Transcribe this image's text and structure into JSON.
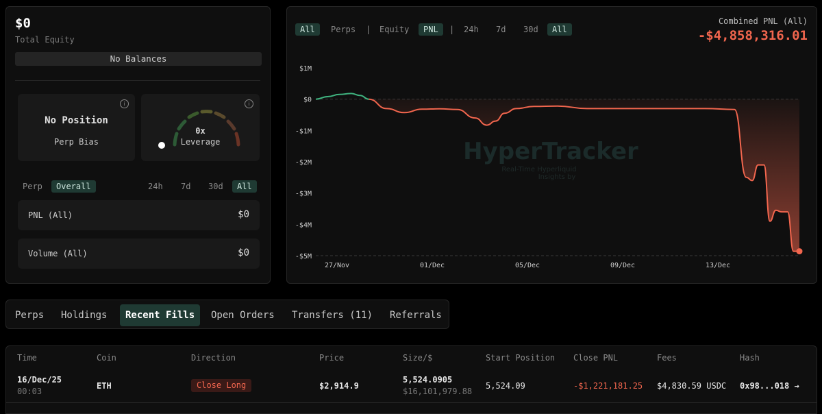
{
  "account": {
    "equity_value": "$0",
    "equity_label": "Total Equity",
    "no_balances": "No Balances"
  },
  "bias_card": {
    "title": "No Position",
    "subtitle": "Perp Bias",
    "info": "i"
  },
  "leverage_card": {
    "value": "0x",
    "label": "Leverage",
    "info": "i",
    "level": 0
  },
  "left_tabs": {
    "type_tabs": [
      "Perp",
      "Overall"
    ],
    "type_active": "Overall",
    "range_tabs": [
      "24h",
      "7d",
      "30d",
      "All"
    ],
    "range_active": "All"
  },
  "stats": [
    {
      "label": "PNL (All)",
      "value": "$0"
    },
    {
      "label": "Volume (All)",
      "value": "$0"
    }
  ],
  "chart_panel": {
    "market_tabs": [
      "All",
      "Perps",
      "Equity",
      "PNL"
    ],
    "separator": "|",
    "range_tabs": [
      "24h",
      "7d",
      "30d",
      "All"
    ],
    "combined_label": "Combined PNL (All)",
    "combined_value": "-$4,858,316.01",
    "watermark_title": "HyperTracker",
    "watermark_line1": "Real-Time Hyperliquid",
    "watermark_line2": "Insights by"
  },
  "colors": {
    "accent": "#1f3a33",
    "negative": "#f2664e",
    "positive": "#3fb37f",
    "panel": "#0f0f0f"
  },
  "chart_data": {
    "type": "area",
    "title": "Combined PNL (All)",
    "xlabel": "",
    "ylabel": "",
    "x_ticks": [
      "27/Nov",
      "01/Dec",
      "05/Dec",
      "09/Dec",
      "13/Dec"
    ],
    "y_ticks": [
      "$1M",
      "$0",
      "-$1M",
      "-$2M",
      "-$3M",
      "-$4M",
      "-$5M"
    ],
    "ylim": [
      -5000000,
      1000000
    ],
    "xlim": [
      25.8,
      42.2
    ],
    "x_note": "day index: 27=27/Nov, 31=01/Dec, 35=05/Dec, 39=09/Dec, 43=13/Dec",
    "grid": false,
    "series": [
      {
        "name": "PNL",
        "x": [
          25.8,
          26.2,
          26.6,
          27.0,
          27.3,
          27.6,
          28.2,
          28.8,
          29.4,
          30.0,
          30.6,
          31.2,
          31.6,
          31.9,
          32.2,
          32.6,
          33.2,
          34.0,
          35.0,
          36.0,
          37.0,
          38.0,
          39.0,
          40.0,
          40.4,
          40.6,
          40.8,
          41.0,
          41.2,
          41.4,
          41.6,
          41.8,
          42.0,
          42.2
        ],
        "values": [
          0,
          80000,
          150000,
          180000,
          120000,
          0,
          -300000,
          -430000,
          -320000,
          -310000,
          -330000,
          -600000,
          -830000,
          -700000,
          -450000,
          -300000,
          -230000,
          -220000,
          -300000,
          -300000,
          -300000,
          -300000,
          -300000,
          -330000,
          -2500000,
          -2600000,
          -2100000,
          -2100000,
          -3900000,
          -3550000,
          -3600000,
          -3600000,
          -4860000,
          -4860000
        ]
      }
    ]
  },
  "bottom_tabs": [
    "Perps",
    "Holdings",
    "Recent Fills",
    "Open Orders",
    "Transfers (11)",
    "Referrals"
  ],
  "bottom_tab_active": "Recent Fills",
  "table": {
    "headers": [
      "Time",
      "Coin",
      "Direction",
      "Price",
      "Size/$",
      "Start Position",
      "Close PNL",
      "Fees",
      "Hash"
    ],
    "rows": [
      {
        "date": "16/Dec/25",
        "time": "00:03",
        "coin": "ETH",
        "direction": "Close Long",
        "price": "$2,914.9",
        "size": "5,524.0905",
        "size_usd": "$16,101,979.88",
        "start_position": "5,524.09",
        "close_pnl": "-$1,221,181.25",
        "fees": "$4,830.59 USDC",
        "hash": "0x98...018 →"
      }
    ]
  }
}
